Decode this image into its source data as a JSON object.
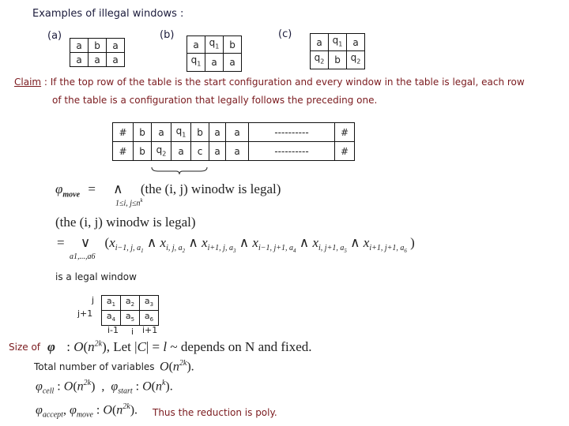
{
  "heading": "Examples of illegal windows :",
  "examples": [
    {
      "label": "(a)",
      "rows": [
        [
          "a",
          "b",
          "a"
        ],
        [
          "a",
          "a",
          "a"
        ]
      ]
    },
    {
      "label": "(b)",
      "rows": [
        [
          "a",
          "q1",
          "b"
        ],
        [
          "q1",
          "a",
          "a"
        ]
      ]
    },
    {
      "label": "(c)",
      "rows": [
        [
          "a",
          "q1",
          "a"
        ],
        [
          "q2",
          "b",
          "q2"
        ]
      ]
    }
  ],
  "claim": {
    "label": "Claim",
    "separator": " : ",
    "line1": "If the top row of the table is the start configuration and every window in the table is legal, each row",
    "line2": "of the table is a configuration that legally follows the preceding one."
  },
  "config_table": {
    "rows": [
      [
        "#",
        "b",
        "a",
        "q1",
        "b",
        "a",
        "a",
        "----------",
        "#"
      ],
      [
        "#",
        "b",
        "q2",
        "a",
        "c",
        "a",
        "a",
        "----------",
        "#"
      ]
    ]
  },
  "formulas": {
    "phi_move_lhs": "φ",
    "phi_move_sub": "move",
    "equals": "=",
    "and_op": "∧",
    "and_range": "1≤i, j≤n",
    "and_range_sup": "k",
    "window_text": "(the  (i, j)  winodw is legal)",
    "window_text2": "(the  (i, j)  winodw is legal)",
    "or_op": "∨",
    "or_range": "a1,...,a6",
    "expansion": "(x_{i-1,j,a1} ∧ x_{i,j,a2} ∧ x_{i+1,j,a3} ∧ x_{i-1,j+1,a4} ∧ x_{i,j+1,a5} ∧ x_{i+1,j+1,a6})"
  },
  "legal_window": {
    "caption": "is a legal window",
    "row_labels": [
      "j",
      "j+1"
    ],
    "col_labels": [
      "i-1",
      "i",
      "i+1"
    ],
    "rows": [
      [
        "a1",
        "a2",
        "a3"
      ],
      [
        "a4",
        "a5",
        "a6"
      ]
    ]
  },
  "size": {
    "label": "Size of",
    "phi": "φ",
    "text": ": O(n^2k), Let |C| = l ~ depends on N and fixed.",
    "depends": "~ depends  on  N  and  fixed."
  },
  "total_vars": {
    "label": "Total number of variables",
    "value": "O(n^2k)."
  },
  "cell_start": {
    "cell": "φcell : O(n^2k)",
    "start": "φstart : O(n^k)."
  },
  "accept_move": {
    "text": "φaccept, φmove : O(n^2k).",
    "conclusion": "Thus the reduction is poly."
  }
}
